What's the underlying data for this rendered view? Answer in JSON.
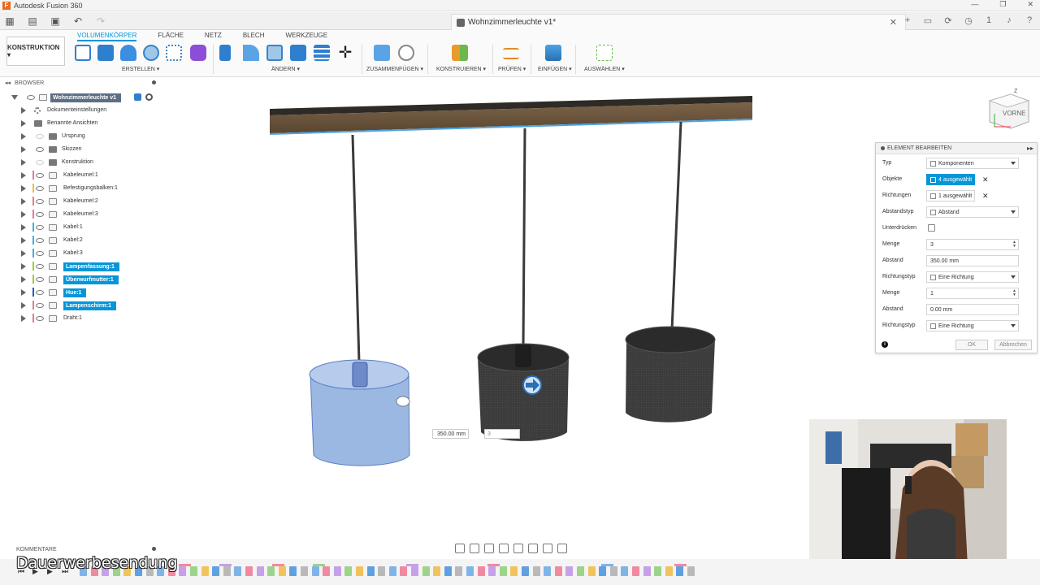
{
  "app": {
    "title": "Autodesk Fusion 360",
    "logo_letter": "F"
  },
  "window": {
    "controls": [
      "—",
      "❐",
      "✕"
    ]
  },
  "quick_access": {
    "icons": [
      "grid-icon",
      "file-icon",
      "save-icon",
      "undo-icon",
      "redo-icon"
    ]
  },
  "document": {
    "tab_title": "Wohnzimmerleuchte v1*",
    "close": "✕"
  },
  "right_cluster": {
    "icons": [
      "plus-icon",
      "comment-icon",
      "refresh-icon",
      "clock-icon",
      "bell-icon",
      "help-icon"
    ],
    "job_count": "1"
  },
  "ribbon": {
    "workspace": "KONSTRUKTION ▾",
    "tabs": [
      "VOLUMENKÖRPER",
      "FLÄCHE",
      "NETZ",
      "BLECH",
      "WERKZEUGE"
    ],
    "active_tab": "VOLUMENKÖRPER",
    "groups": [
      "ERSTELLEN ▾",
      "ÄNDERN ▾",
      "ZUSAMMENFÜGEN ▾",
      "KONSTRUIEREN ▾",
      "PRÜFEN ▾",
      "EINFÜGEN ▾",
      "AUSWÄHLEN ▾"
    ]
  },
  "browser": {
    "title": "BROWSER",
    "root": "Wohnzimmerleuchte v1",
    "items": [
      {
        "label": "Dokumenteinstellungen",
        "type": "settings",
        "color": ""
      },
      {
        "label": "Benannte Ansichten",
        "type": "folder",
        "color": ""
      },
      {
        "label": "Ursprung",
        "type": "folder-hidden",
        "color": ""
      },
      {
        "label": "Skizzen",
        "type": "folder",
        "color": ""
      },
      {
        "label": "Konstruktion",
        "type": "folder-hidden",
        "color": ""
      },
      {
        "label": "Kabeleumel:1",
        "type": "component",
        "color": "#e87a8a"
      },
      {
        "label": "Befestigungsbalken:1",
        "type": "component",
        "color": "#e8c33a"
      },
      {
        "label": "Kabeleumel:2",
        "type": "component",
        "color": "#e87a8a"
      },
      {
        "label": "Kabeleumel:3",
        "type": "component",
        "color": "#e87a8a"
      },
      {
        "label": "Kabel:1",
        "type": "component",
        "color": "#3ab0e8"
      },
      {
        "label": "Kabel:2",
        "type": "component",
        "color": "#3ab0e8"
      },
      {
        "label": "Kabel:3",
        "type": "component",
        "color": "#3ab0e8"
      },
      {
        "label": "Lampenfassung:1",
        "type": "component",
        "color": "#9bcf3a",
        "selected": true
      },
      {
        "label": "Überwurfmutter:1",
        "type": "component",
        "color": "#9bcf3a",
        "selected": true
      },
      {
        "label": "Hue:1",
        "type": "component",
        "color": "#2a57c9",
        "selected": true
      },
      {
        "label": "Lampenschirm:1",
        "type": "component",
        "color": "#e87a8a",
        "selected": true
      },
      {
        "label": "Draht:1",
        "type": "component",
        "color": "#e87a8a"
      }
    ]
  },
  "panel": {
    "title": "ELEMENT BEARBEITEN",
    "rows": [
      {
        "label": "Typ",
        "value": "Komponenten",
        "kind": "dropdown"
      },
      {
        "label": "Objekte",
        "value": "4 ausgewählt",
        "kind": "selection-active"
      },
      {
        "label": "Richtungen",
        "value": "1 ausgewählt",
        "kind": "selection"
      },
      {
        "label": "Abstandstyp",
        "value": "Abstand",
        "kind": "dropdown"
      },
      {
        "label": "Unterdrücken",
        "value": "",
        "kind": "checkbox"
      },
      {
        "label": "Menge",
        "value": "3",
        "kind": "spinner"
      },
      {
        "label": "Abstand",
        "value": "350.00 mm",
        "kind": "text"
      },
      {
        "label": "Richtungstyp",
        "value": "Eine Richtung",
        "kind": "dropdown"
      },
      {
        "label": "Menge",
        "value": "1",
        "kind": "spinner"
      },
      {
        "label": "Abstand",
        "value": "0.00 mm",
        "kind": "text"
      },
      {
        "label": "Richtungstyp",
        "value": "Eine Richtung",
        "kind": "dropdown"
      }
    ],
    "ok": "OK",
    "cancel": "Abbrechen",
    "info": "i"
  },
  "canvas": {
    "dim_value": "350.00 mm",
    "dim_count": "3",
    "viewcube_label": "VORNE",
    "axis_z": "Z"
  },
  "comments": {
    "title": "KOMMENTARE"
  },
  "overlay": {
    "caption": "Dauerwerbesendung"
  },
  "colors": {
    "accent": "#0696d7",
    "selection": "#6e9ad6"
  }
}
